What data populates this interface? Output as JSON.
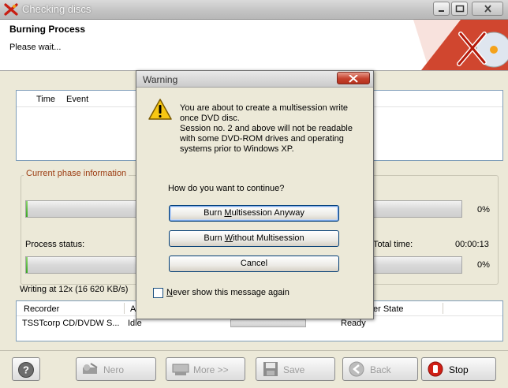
{
  "window": {
    "title": "Checking discs"
  },
  "header": {
    "title": "Burning Process",
    "subtitle": "Please wait..."
  },
  "log": {
    "columns": [
      "Time",
      "Event"
    ]
  },
  "phase": {
    "group_label": "Current phase information",
    "phase_progress": 0.0,
    "phase_percent": "0%",
    "process_status_label": "Process status:",
    "total_time_label": "Total time:",
    "total_time_value": "00:00:13",
    "process_progress": 0.0,
    "process_percent": "0%",
    "writing_speed": "Writing at 12x (16 620 KB/s)"
  },
  "recorder_table": {
    "columns": [
      "Recorder",
      "A",
      "er State"
    ],
    "rows": [
      {
        "recorder": "TSSTcorp CD/DVDW S...",
        "action": "Idle",
        "state": "Ready"
      }
    ]
  },
  "footer": {
    "help": "?",
    "nero": "Nero",
    "more": "More >>",
    "save": "Save",
    "back": "Back",
    "stop": "Stop"
  },
  "dialog": {
    "title": "Warning",
    "message": [
      "You are about to create a multisession write",
      "once DVD disc.",
      "Session no. 2 and above will not be readable",
      "with some DVD-ROM drives and operating",
      "systems prior to Windows XP."
    ],
    "question": "How do you want to continue?",
    "buttons": {
      "burn_multisession_pre": "Burn ",
      "burn_multisession_accel": "M",
      "burn_multisession_post": "ultisession Anyway",
      "burn_without_pre": "Burn ",
      "burn_without_accel": "W",
      "burn_without_post": "ithout Multisession",
      "cancel": "Cancel"
    },
    "checkbox_accel": "N",
    "checkbox_rest": "ever show this message again",
    "checkbox_checked": false
  },
  "colors": {
    "group_label": "#9c3d12",
    "progress_fill": "#3aa623",
    "dialog_close": "#c5412d"
  }
}
